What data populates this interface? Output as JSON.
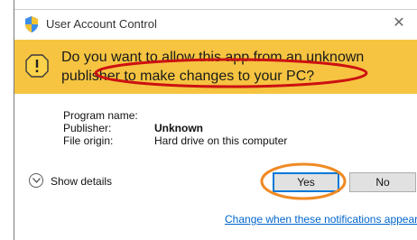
{
  "window": {
    "title": "User Account Control",
    "close_glyph": "✕"
  },
  "banner": {
    "question_line1": "Do you want to allow this app from an unknown",
    "question_line2": "publisher to make changes to your PC?",
    "color": "#f6c441"
  },
  "fields": [
    {
      "label": "Program name:",
      "value": ""
    },
    {
      "label": "Publisher:",
      "value": "Unknown"
    },
    {
      "label": "File origin:",
      "value": "Hard drive on this computer"
    }
  ],
  "footer": {
    "show_details": "Show details",
    "yes_label": "Yes",
    "no_label": "No",
    "notifications_link": "Change when these notifications appear"
  },
  "annotations": {
    "ellipse_color": "#cc1111",
    "circle_color": "#f08a24"
  }
}
